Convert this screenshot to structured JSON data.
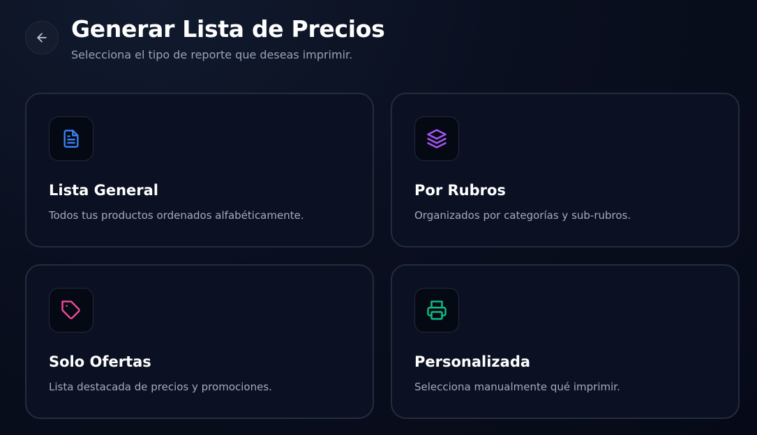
{
  "header": {
    "back_icon": "arrow-left-icon",
    "title": "Generar Lista de Precios",
    "subtitle": "Selecciona el tipo de reporte que deseas imprimir."
  },
  "cards": [
    {
      "title": "Lista General",
      "description": "Todos tus productos ordenados alfabéticamente.",
      "icon": "file-text-icon",
      "accent": "#3b82f6"
    },
    {
      "title": "Por Rubros",
      "description": "Organizados por categorías y sub-rubros.",
      "icon": "layers-icon",
      "accent": "#a855f7"
    },
    {
      "title": "Solo Ofertas",
      "description": "Lista destacada de precios y promociones.",
      "icon": "tag-icon",
      "accent": "#ec4899"
    },
    {
      "title": "Personalizada",
      "description": "Selecciona manualmente qué imprimir.",
      "icon": "printer-icon",
      "accent": "#10b981"
    }
  ]
}
